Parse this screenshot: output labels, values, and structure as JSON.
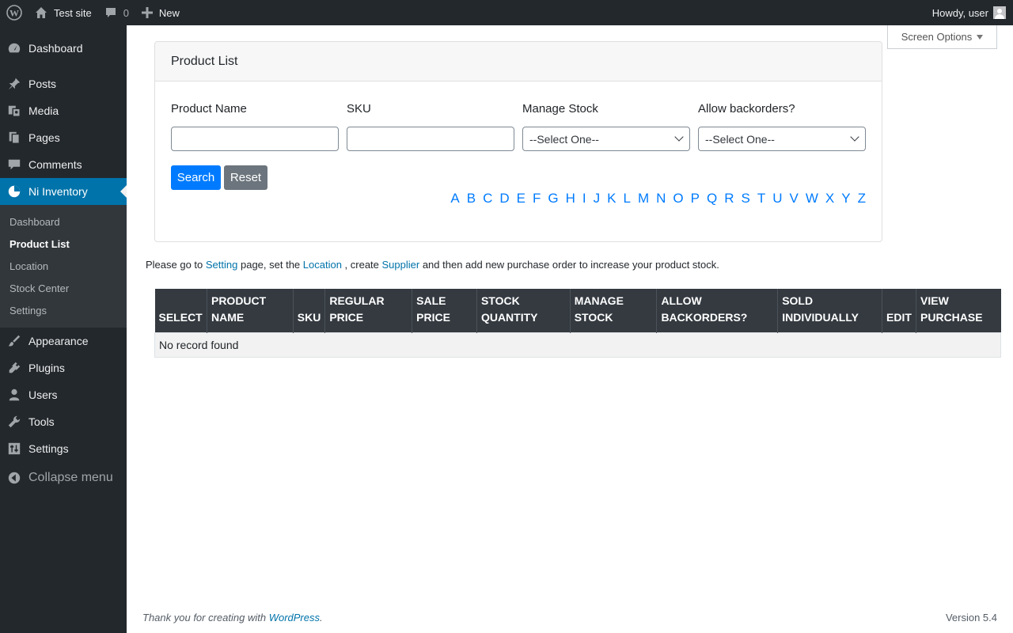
{
  "admin_bar": {
    "site_name": "Test site",
    "comments_count": "0",
    "new_label": "New",
    "greeting": "Howdy, user"
  },
  "sidebar": {
    "menu_top": [
      {
        "label": "Dashboard",
        "icon": "dashboard-icon"
      },
      {
        "label": "Posts",
        "icon": "pin-icon"
      },
      {
        "label": "Media",
        "icon": "media-icon"
      },
      {
        "label": "Pages",
        "icon": "pages-icon"
      },
      {
        "label": "Comments",
        "icon": "comment-icon"
      },
      {
        "label": "Ni Inventory",
        "icon": "pie-chart-icon"
      }
    ],
    "submenu": [
      "Dashboard",
      "Product List",
      "Location",
      "Stock Center",
      "Settings"
    ],
    "menu_bottom": [
      {
        "label": "Appearance",
        "icon": "brush-icon"
      },
      {
        "label": "Plugins",
        "icon": "plug-icon"
      },
      {
        "label": "Users",
        "icon": "user-icon"
      },
      {
        "label": "Tools",
        "icon": "wrench-icon"
      },
      {
        "label": "Settings",
        "icon": "sliders-icon"
      }
    ],
    "collapse_label": "Collapse menu"
  },
  "screen_options_label": "Screen Options",
  "filter": {
    "title": "Product List",
    "product_name_label": "Product Name",
    "product_name_value": "",
    "sku_label": "SKU",
    "sku_value": "",
    "manage_stock_label": "Manage Stock",
    "manage_stock_value": "--Select One--",
    "backorders_label": "Allow backorders?",
    "backorders_value": "--Select One--",
    "search_label": "Search",
    "reset_label": "Reset",
    "letters": [
      "A",
      "B",
      "C",
      "D",
      "E",
      "F",
      "G",
      "H",
      "I",
      "J",
      "K",
      "L",
      "M",
      "N",
      "O",
      "P",
      "Q",
      "R",
      "S",
      "T",
      "U",
      "V",
      "W",
      "X",
      "Y",
      "Z"
    ]
  },
  "info": {
    "t1": "Please go to ",
    "setting_link": "Setting",
    "t2": " page, set the ",
    "location_link": "Location",
    "t3": " , create ",
    "supplier_link": "Supplier",
    "t4": " and then add new purchase order to increase your product stock."
  },
  "table": {
    "headers": [
      [
        "SELECT"
      ],
      [
        "PRODUCT",
        "NAME"
      ],
      [
        "SKU"
      ],
      [
        "REGULAR",
        "PRICE"
      ],
      [
        "SALE",
        "PRICE"
      ],
      [
        "STOCK",
        "QUANTITY"
      ],
      [
        "MANAGE",
        "STOCK"
      ],
      [
        "ALLOW",
        "BACKORDERS?"
      ],
      [
        "SOLD",
        "INDIVIDUALLY"
      ],
      [
        "EDIT"
      ],
      [
        "VIEW",
        "PURCHASE"
      ]
    ],
    "empty_message": "No record found"
  },
  "footer": {
    "thanks_text": "Thank you for creating with ",
    "wp_link": "WordPress",
    "thanks_end": ".",
    "version": "Version 5.4"
  }
}
